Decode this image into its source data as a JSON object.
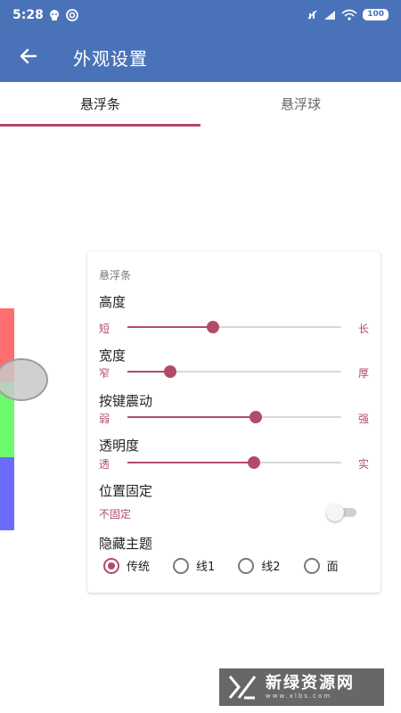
{
  "status_bar": {
    "time": "5:28",
    "icons": [
      "app-notification-icon",
      "sync-icon",
      "mute-icon",
      "signal-icon",
      "wifi-icon"
    ],
    "battery": "100"
  },
  "app_bar": {
    "title": "外观设置",
    "back_icon": "arrow-left-icon"
  },
  "tabs": [
    {
      "label": "悬浮条",
      "active": true
    },
    {
      "label": "悬浮球",
      "active": false
    }
  ],
  "floating_bar": {
    "colors": [
      "#fe6e6e",
      "#6dfb6b",
      "#6c6cfc"
    ]
  },
  "settings": {
    "section_title": "悬浮条",
    "sliders": [
      {
        "title": "高度",
        "min_label": "短",
        "max_label": "长",
        "value": 0.4
      },
      {
        "title": "宽度",
        "min_label": "窄",
        "max_label": "厚",
        "value": 0.2
      },
      {
        "title": "按键震动",
        "min_label": "弱",
        "max_label": "强",
        "value": 0.6
      },
      {
        "title": "透明度",
        "min_label": "透",
        "max_label": "实",
        "value": 0.59
      }
    ],
    "position_lock": {
      "title": "位置固定",
      "status": "不固定",
      "enabled": false
    },
    "hide_theme": {
      "title": "隐藏主题",
      "options": [
        {
          "label": "传统",
          "selected": true
        },
        {
          "label": "线1",
          "selected": false
        },
        {
          "label": "线2",
          "selected": false
        },
        {
          "label": "面",
          "selected": false
        }
      ]
    }
  },
  "watermark": {
    "text": "新绿资源网",
    "subtext": "www.xlbs.com"
  },
  "colors": {
    "primary": "#4a72b8",
    "accent": "#b34b68"
  }
}
